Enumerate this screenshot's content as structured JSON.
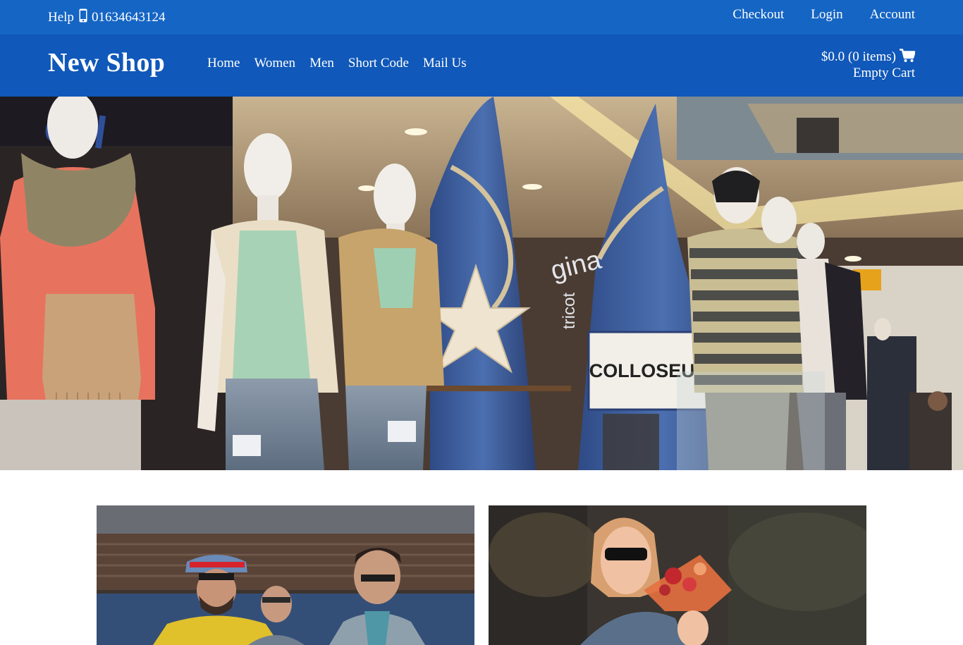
{
  "topbar": {
    "help_label": "Help",
    "phone_icon": "mobile-phone-icon",
    "phone_number": "01634643124",
    "links": [
      {
        "label": "Checkout"
      },
      {
        "label": "Login"
      },
      {
        "label": "Account"
      }
    ]
  },
  "header": {
    "logo": "New Shop",
    "nav": [
      {
        "label": "Home"
      },
      {
        "label": "Women"
      },
      {
        "label": "Men"
      },
      {
        "label": "Short Code"
      },
      {
        "label": "Mail Us"
      }
    ],
    "cart": {
      "summary": "$0.0 (0 items)",
      "icon": "shopping-cart-icon",
      "empty_label": "Empty Cart"
    }
  },
  "hero": {
    "sign_text": "COLLOSEUM"
  },
  "colors": {
    "topbar_bg": "#1565c4",
    "header_bg": "#1058b9",
    "text": "#ffffff"
  }
}
